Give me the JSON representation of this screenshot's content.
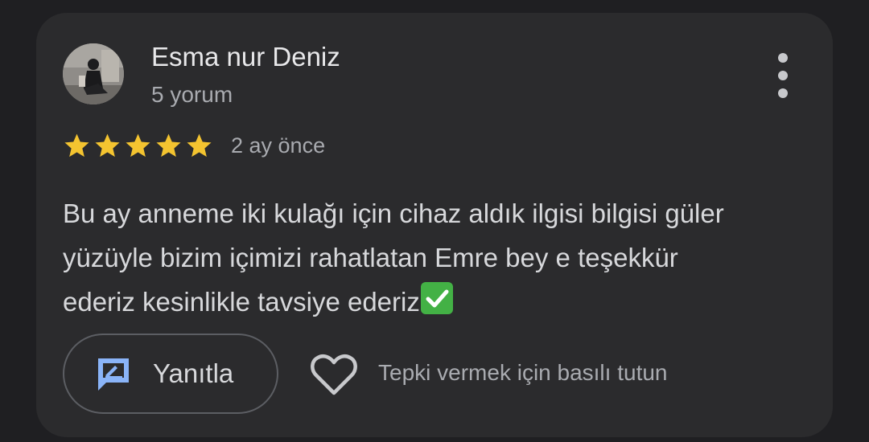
{
  "review": {
    "author": {
      "name": "Esma nur Deniz",
      "review_count": "5 yorum"
    },
    "rating": {
      "stars": 5,
      "max": 5,
      "star_color": "#f4c430"
    },
    "date": "2 ay önce",
    "text_lines": [
      "Bu ay anneme iki kulağı için cihaz aldık ilgisi bilgisi güler",
      "yüzüyle bizim içimizi rahatlatan Emre bey e teşekkür",
      "ederiz kesinlikle tavsiye ederiz"
    ],
    "text_emoji": "check-mark-icon"
  },
  "actions": {
    "reply_label": "Yanıtla",
    "react_hint": "Tepki vermek için basılı tutun",
    "more_icon": "more-vertical-icon",
    "reply_icon": "reply-icon",
    "react_icon": "heart-icon"
  },
  "colors": {
    "background": "#1f1f22",
    "card": "#2b2b2d",
    "accent": "#8ab4f8",
    "check": "#43b145"
  }
}
